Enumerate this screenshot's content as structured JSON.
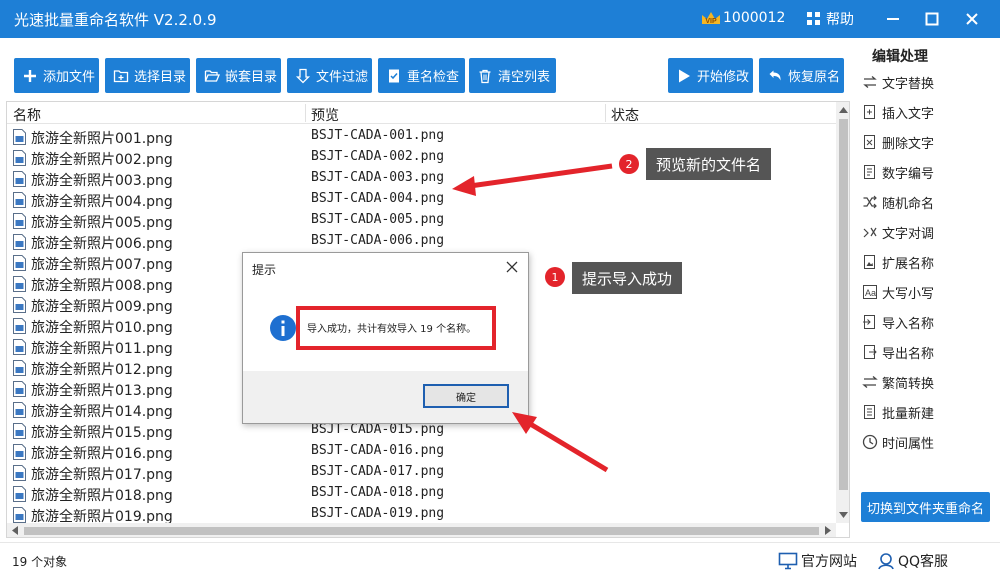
{
  "app": {
    "title": "光速批量重命名软件 V2.2.0.9",
    "user_id": "1000012",
    "help_label": "帮助"
  },
  "toolbar": {
    "add_files": "添加文件",
    "select_dir": "选择目录",
    "nested_dir": "嵌套目录",
    "file_filter": "文件过滤",
    "rename_check": "重名检查",
    "clear_list": "清空列表",
    "start_modify": "开始修改",
    "restore_names": "恢复原名"
  },
  "list": {
    "columns": {
      "name": "名称",
      "preview": "预览",
      "status": "状态"
    },
    "rows": [
      {
        "name": "旅游全新照片001.png",
        "preview": "BSJT-CADA-001.png"
      },
      {
        "name": "旅游全新照片002.png",
        "preview": "BSJT-CADA-002.png"
      },
      {
        "name": "旅游全新照片003.png",
        "preview": "BSJT-CADA-003.png"
      },
      {
        "name": "旅游全新照片004.png",
        "preview": "BSJT-CADA-004.png"
      },
      {
        "name": "旅游全新照片005.png",
        "preview": "BSJT-CADA-005.png"
      },
      {
        "name": "旅游全新照片006.png",
        "preview": "BSJT-CADA-006.png"
      },
      {
        "name": "旅游全新照片007.png",
        "preview": ""
      },
      {
        "name": "旅游全新照片008.png",
        "preview": ""
      },
      {
        "name": "旅游全新照片009.png",
        "preview": ""
      },
      {
        "name": "旅游全新照片010.png",
        "preview": ""
      },
      {
        "name": "旅游全新照片011.png",
        "preview": ""
      },
      {
        "name": "旅游全新照片012.png",
        "preview": ""
      },
      {
        "name": "旅游全新照片013.png",
        "preview": ""
      },
      {
        "name": "旅游全新照片014.png",
        "preview": ""
      },
      {
        "name": "旅游全新照片015.png",
        "preview": "BSJT-CADA-015.png"
      },
      {
        "name": "旅游全新照片016.png",
        "preview": "BSJT-CADA-016.png"
      },
      {
        "name": "旅游全新照片017.png",
        "preview": "BSJT-CADA-017.png"
      },
      {
        "name": "旅游全新照片018.png",
        "preview": "BSJT-CADA-018.png"
      },
      {
        "name": "旅游全新照片019.png",
        "preview": "BSJT-CADA-019.png"
      }
    ]
  },
  "sidebar": {
    "heading": "编辑处理",
    "items": [
      {
        "label": "文字替换",
        "icon": "replace-icon"
      },
      {
        "label": "插入文字",
        "icon": "insert-icon"
      },
      {
        "label": "删除文字",
        "icon": "delete-icon"
      },
      {
        "label": "数字编号",
        "icon": "numbering-icon"
      },
      {
        "label": "随机命名",
        "icon": "shuffle-icon"
      },
      {
        "label": "文字对调",
        "icon": "swap-icon"
      },
      {
        "label": "扩展名称",
        "icon": "extension-icon"
      },
      {
        "label": "大写小写",
        "icon": "case-icon"
      },
      {
        "label": "导入名称",
        "icon": "import-icon"
      },
      {
        "label": "导出名称",
        "icon": "export-icon"
      },
      {
        "label": "繁简转换",
        "icon": "convert-icon"
      },
      {
        "label": "批量新建",
        "icon": "batch-new-icon"
      },
      {
        "label": "时间属性",
        "icon": "clock-icon"
      }
    ],
    "switch_button": "切换到文件夹重命名"
  },
  "status": {
    "count": "19 个对象",
    "official_site": "官方网站",
    "qq_support": "QQ客服"
  },
  "dialog": {
    "title": "提示",
    "message": "导入成功，共计有效导入 19 个名称。",
    "ok": "确定"
  },
  "annotations": {
    "callout_1": {
      "number": "1",
      "text": "提示导入成功"
    },
    "callout_2": {
      "number": "2",
      "text": "预览新的文件名"
    }
  },
  "colors": {
    "primary": "#1e7fd6",
    "highlight": "#e3242b",
    "callout_bg": "#555555"
  }
}
